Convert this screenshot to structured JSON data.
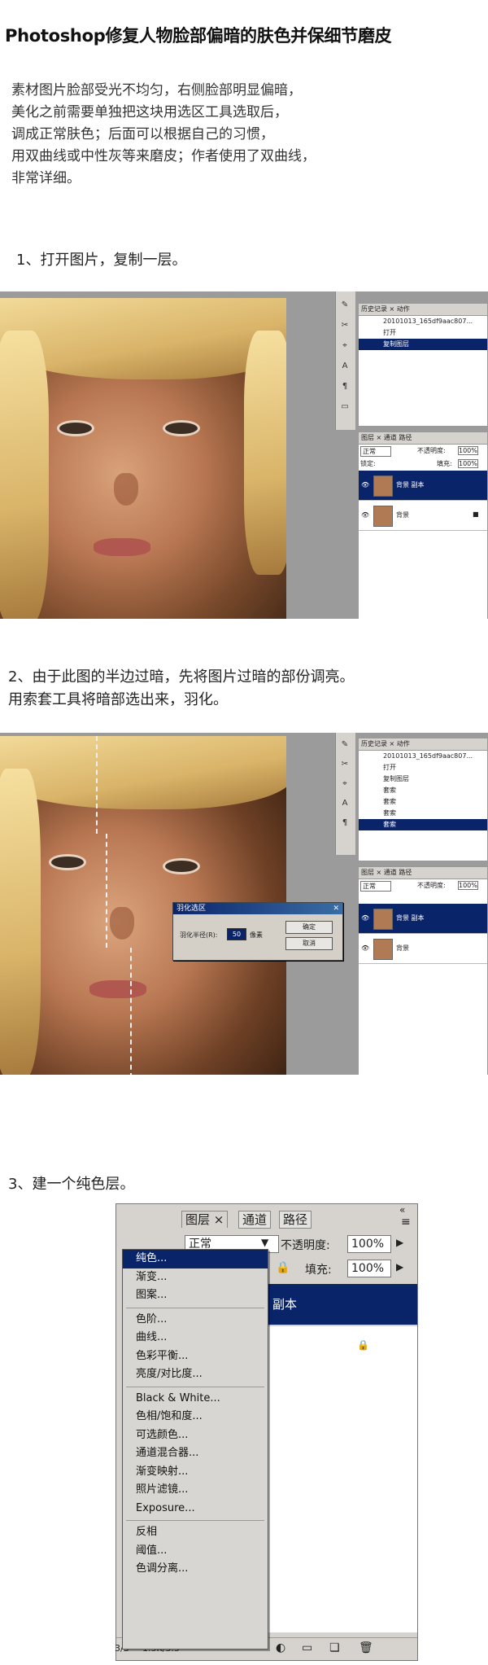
{
  "title": "Photoshop修复人物脸部偏暗的肤色并保细节磨皮",
  "intro_lines": [
    "素材图片脸部受光不均匀，右侧脸部明显偏暗，",
    "美化之前需要单独把这块用选区工具选取后，",
    "调成正常肤色；后面可以根据自己的习惯，",
    "用双曲线或中性灰等来磨皮；作者使用了双曲线，",
    "非常详细。"
  ],
  "step1": {
    "text": "1、打开图片，复制一层。",
    "history_tabs": "历史记录 × 动作",
    "history_items": [
      "20101013_165df9aac807...",
      "打开",
      "复制图层"
    ],
    "layers_tabs": "图层 × 通道 路径",
    "blend_mode": "正常",
    "opacity_label": "不透明度:",
    "opacity": "100%",
    "lock_label": "锁定:",
    "fill_label": "填充:",
    "fill": "100%",
    "layers": [
      "背景 副本",
      "背景"
    ]
  },
  "step2": {
    "text_line1": "2、由于此图的半边过暗，先将图片过暗的部份调亮。",
    "text_line2": "用索套工具将暗部选出来，羽化。",
    "history_tabs": "历史记录 × 动作",
    "history_items": [
      "20101013_165df9aac807...",
      "打开",
      "复制图层",
      "套索",
      "套索",
      "套索",
      "套索"
    ],
    "layers_tabs": "图层 × 通道 路径",
    "blend_mode": "正常",
    "opacity_label": "不透明度:",
    "opacity": "100%",
    "layers": [
      "背景 副本",
      "背景"
    ],
    "dialog": {
      "title": "羽化选区",
      "radius_label": "羽化半径(R):",
      "radius_value": "50",
      "unit": "像素",
      "ok": "确定",
      "cancel": "取消"
    }
  },
  "step3": {
    "text": "3、建一个纯色层。",
    "tabs": [
      "图层 ×",
      "通道",
      "路径"
    ],
    "blend_mode": "正常",
    "opacity_label": "不透明度:",
    "opacity": "100%",
    "fill_label": "填充:",
    "fill": "100%",
    "layer_partial": "副本",
    "status_text": "3/3",
    "status_size": "1.5K/3.5",
    "menu_groups": [
      [
        "纯色...",
        "渐变...",
        "图案..."
      ],
      [
        "色阶...",
        "曲线...",
        "色彩平衡...",
        "亮度/对比度..."
      ],
      [
        "Black & White...",
        "色相/饱和度...",
        "可选颜色...",
        "通道混合器...",
        "渐变映射...",
        "照片滤镜...",
        "Exposure..."
      ],
      [
        "反相",
        "阈值...",
        "色调分离..."
      ]
    ]
  }
}
